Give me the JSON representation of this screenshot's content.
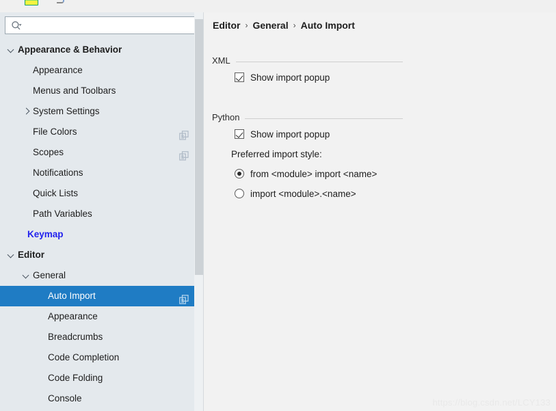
{
  "window": {
    "top_icon": "plugin-icon",
    "clipped_glyph": "cut-off-glyph"
  },
  "sidebar": {
    "search": {
      "value": "",
      "placeholder": "",
      "icon": "search-icon",
      "dropdown_icon": "chevron-down-icon"
    },
    "items": [
      {
        "label": "Appearance & Behavior",
        "level": 0,
        "style": "bold",
        "chevron": "down",
        "copy_icon": false,
        "selected": false
      },
      {
        "label": "Appearance",
        "level": 1,
        "style": "normal",
        "chevron": "none",
        "copy_icon": false,
        "selected": false
      },
      {
        "label": "Menus and Toolbars",
        "level": 1,
        "style": "normal",
        "chevron": "none",
        "copy_icon": false,
        "selected": false
      },
      {
        "label": "System Settings",
        "level": 1,
        "style": "normal",
        "chevron": "right",
        "copy_icon": false,
        "selected": false
      },
      {
        "label": "File Colors",
        "level": 1,
        "style": "normal",
        "chevron": "none",
        "copy_icon": true,
        "selected": false
      },
      {
        "label": "Scopes",
        "level": 1,
        "style": "normal",
        "chevron": "none",
        "copy_icon": true,
        "selected": false
      },
      {
        "label": "Notifications",
        "level": 1,
        "style": "normal",
        "chevron": "none",
        "copy_icon": false,
        "selected": false
      },
      {
        "label": "Quick Lists",
        "level": 1,
        "style": "normal",
        "chevron": "none",
        "copy_icon": false,
        "selected": false
      },
      {
        "label": "Path Variables",
        "level": 1,
        "style": "normal",
        "chevron": "none",
        "copy_icon": false,
        "selected": false
      },
      {
        "label": "Keymap",
        "level": 0,
        "style": "keymap",
        "chevron": "none",
        "copy_icon": false,
        "selected": false
      },
      {
        "label": "Editor",
        "level": 0,
        "style": "bold",
        "chevron": "down",
        "copy_icon": false,
        "selected": false
      },
      {
        "label": "General",
        "level": 1,
        "style": "normal",
        "chevron": "down",
        "copy_icon": false,
        "selected": false
      },
      {
        "label": "Auto Import",
        "level": 2,
        "style": "normal",
        "chevron": "none",
        "copy_icon": true,
        "selected": true
      },
      {
        "label": "Appearance",
        "level": 2,
        "style": "normal",
        "chevron": "none",
        "copy_icon": false,
        "selected": false
      },
      {
        "label": "Breadcrumbs",
        "level": 2,
        "style": "normal",
        "chevron": "none",
        "copy_icon": false,
        "selected": false
      },
      {
        "label": "Code Completion",
        "level": 2,
        "style": "normal",
        "chevron": "none",
        "copy_icon": false,
        "selected": false
      },
      {
        "label": "Code Folding",
        "level": 2,
        "style": "normal",
        "chevron": "none",
        "copy_icon": false,
        "selected": false
      },
      {
        "label": "Console",
        "level": 2,
        "style": "normal",
        "chevron": "none",
        "copy_icon": false,
        "selected": false
      }
    ],
    "selection_color": "#1f7cc4",
    "keymap_color": "#2222ee",
    "background_color": "#e4e9ed",
    "scrollbar": {
      "thumb_color": "#cdd2d6"
    }
  },
  "panel": {
    "background_color": "#f2f2f2",
    "breadcrumb": [
      "Editor",
      "General",
      "Auto Import"
    ],
    "breadcrumb_separator": "›",
    "groups": [
      {
        "title": "XML",
        "options": [
          {
            "type": "checkbox",
            "label": "Show import popup",
            "checked": true
          }
        ]
      },
      {
        "title": "Python",
        "options": [
          {
            "type": "checkbox",
            "label": "Show import popup",
            "checked": true
          },
          {
            "type": "text",
            "label": "Preferred import style:"
          },
          {
            "type": "radio",
            "label": "from <module> import <name>",
            "checked": true
          },
          {
            "type": "radio",
            "label": "import <module>.<name>",
            "checked": false
          }
        ]
      }
    ]
  },
  "watermark": {
    "text": "https://blog.csdn.net/LCY133"
  }
}
